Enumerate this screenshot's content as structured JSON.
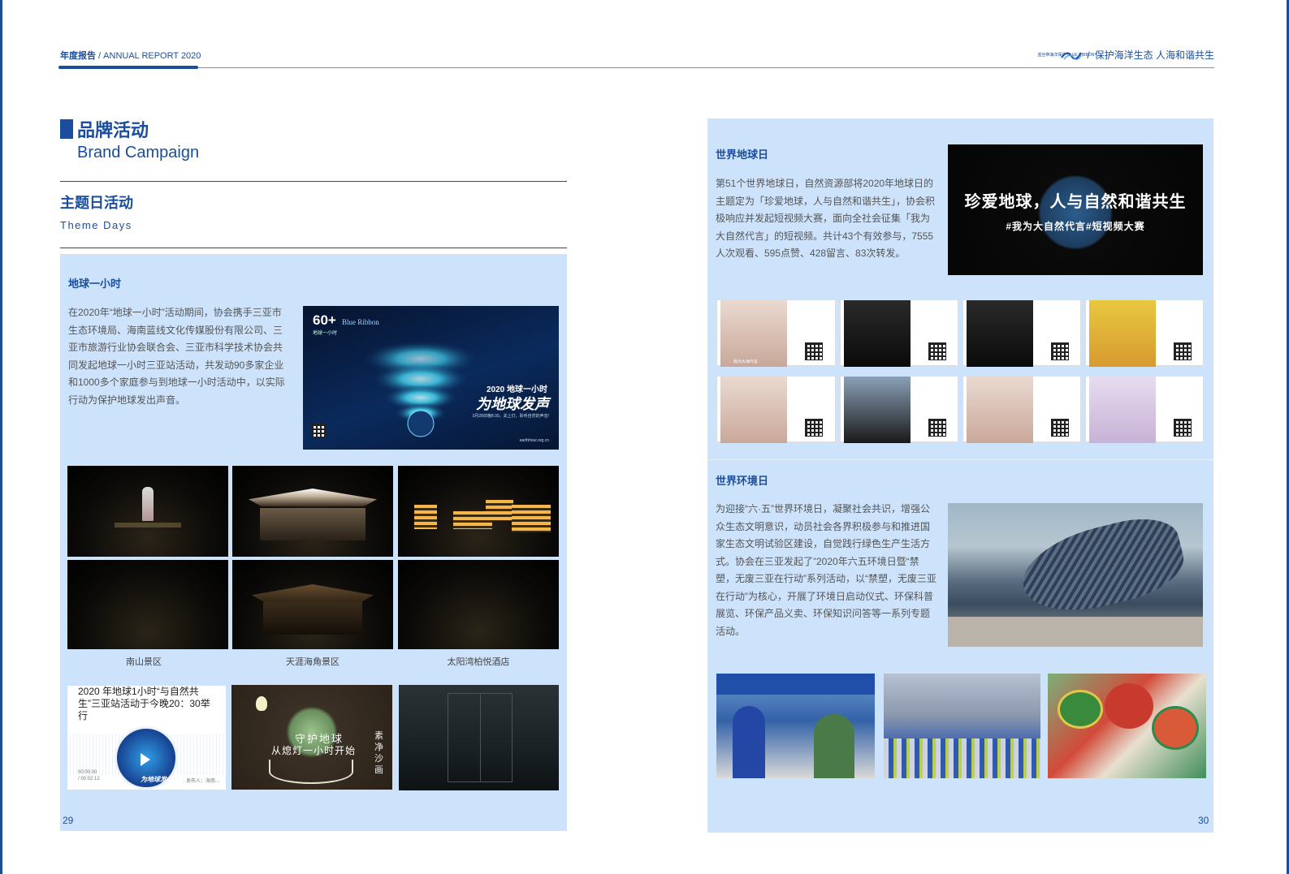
{
  "header": {
    "report_cn": "年度报告",
    "report_sep": " / ",
    "report_en": "ANNUAL REPORT  2020",
    "logo_text": "蓝丝带海洋保护 BLUE RIBBON",
    "slogan_sep": "/",
    "slogan": "保护海洋生态 人海和谐共生"
  },
  "section": {
    "title_cn": "品牌活动",
    "title_en": "Brand Campaign",
    "sub_cn": "主题日活动",
    "sub_en": "Theme Days"
  },
  "earth_hour": {
    "heading": "地球一小时",
    "body": "在2020年“地球一小时”活动期间，协会携手三亚市生态环境局、海南蓝线文化传媒股份有限公司、三亚市旅游行业协会联合会、三亚市科学技术协会共同发起地球一小时三亚站活动，共发动90多家企业和1000多个家庭参与到地球一小时活动中，以实际行动为保护地球发出声音。",
    "poster": {
      "badge": "60+",
      "badge_sub": "地球一小时",
      "brand": "Blue Ribbon",
      "year_line": "2020 地球一小时",
      "slogan": "为地球发声",
      "date_line": "3月28日晚8:30，关上灯，聆听自然的声音!",
      "url": "earthhour.org.cn"
    },
    "captions": [
      "南山景区",
      "天涯海角景区",
      "太阳湾柏悦酒店"
    ],
    "news": {
      "title": "2020 年地球1小时“与自然共生”三亚站活动于今晚20：30举行",
      "time_now": "00:00:00",
      "time_total": "/ 00:02:12",
      "player_label": "为地球发",
      "publisher": "发布人：海南..."
    },
    "plate": {
      "line1": "守护地球",
      "line2": "从熄灯一小时开始",
      "sign": "素净沙画"
    }
  },
  "earth_day": {
    "heading": "世界地球日",
    "body": "第51个世界地球日，自然资源部将2020年地球日的主题定为「珍爱地球，人与自然和谐共生」，协会积极响应并发起短视频大赛，面向全社会征集「我为大自然代言」的短视频。共计43个有效参与，7555人次观看、595点赞、428留言、83次转发。",
    "banner_title": "珍爱地球，人与自然和谐共生",
    "banner_sub": "#我为大自然代言#短视频大赛",
    "video_caption": "我为大海代言"
  },
  "env_day": {
    "heading": "世界环境日",
    "body": "为迎接“六·五”世界环境日，凝聚社会共识，增强公众生态文明意识，动员社会各界积极参与和推进国家生态文明试验区建设，自觉践行绿色生产生活方式。协会在三亚发起了”2020年六五环境日暨“禁塑，无废三亚在行动”系列活动，以“禁塑，无废三亚在行动”为核心，开展了环境日启动仪式、环保科普展览、环保产品义卖、环保知识问答等一系列专题活动。"
  },
  "pages": {
    "left": "29",
    "right": "30"
  },
  "colors": {
    "accent": "#1a4d9c",
    "panel": "#cde3fb"
  }
}
